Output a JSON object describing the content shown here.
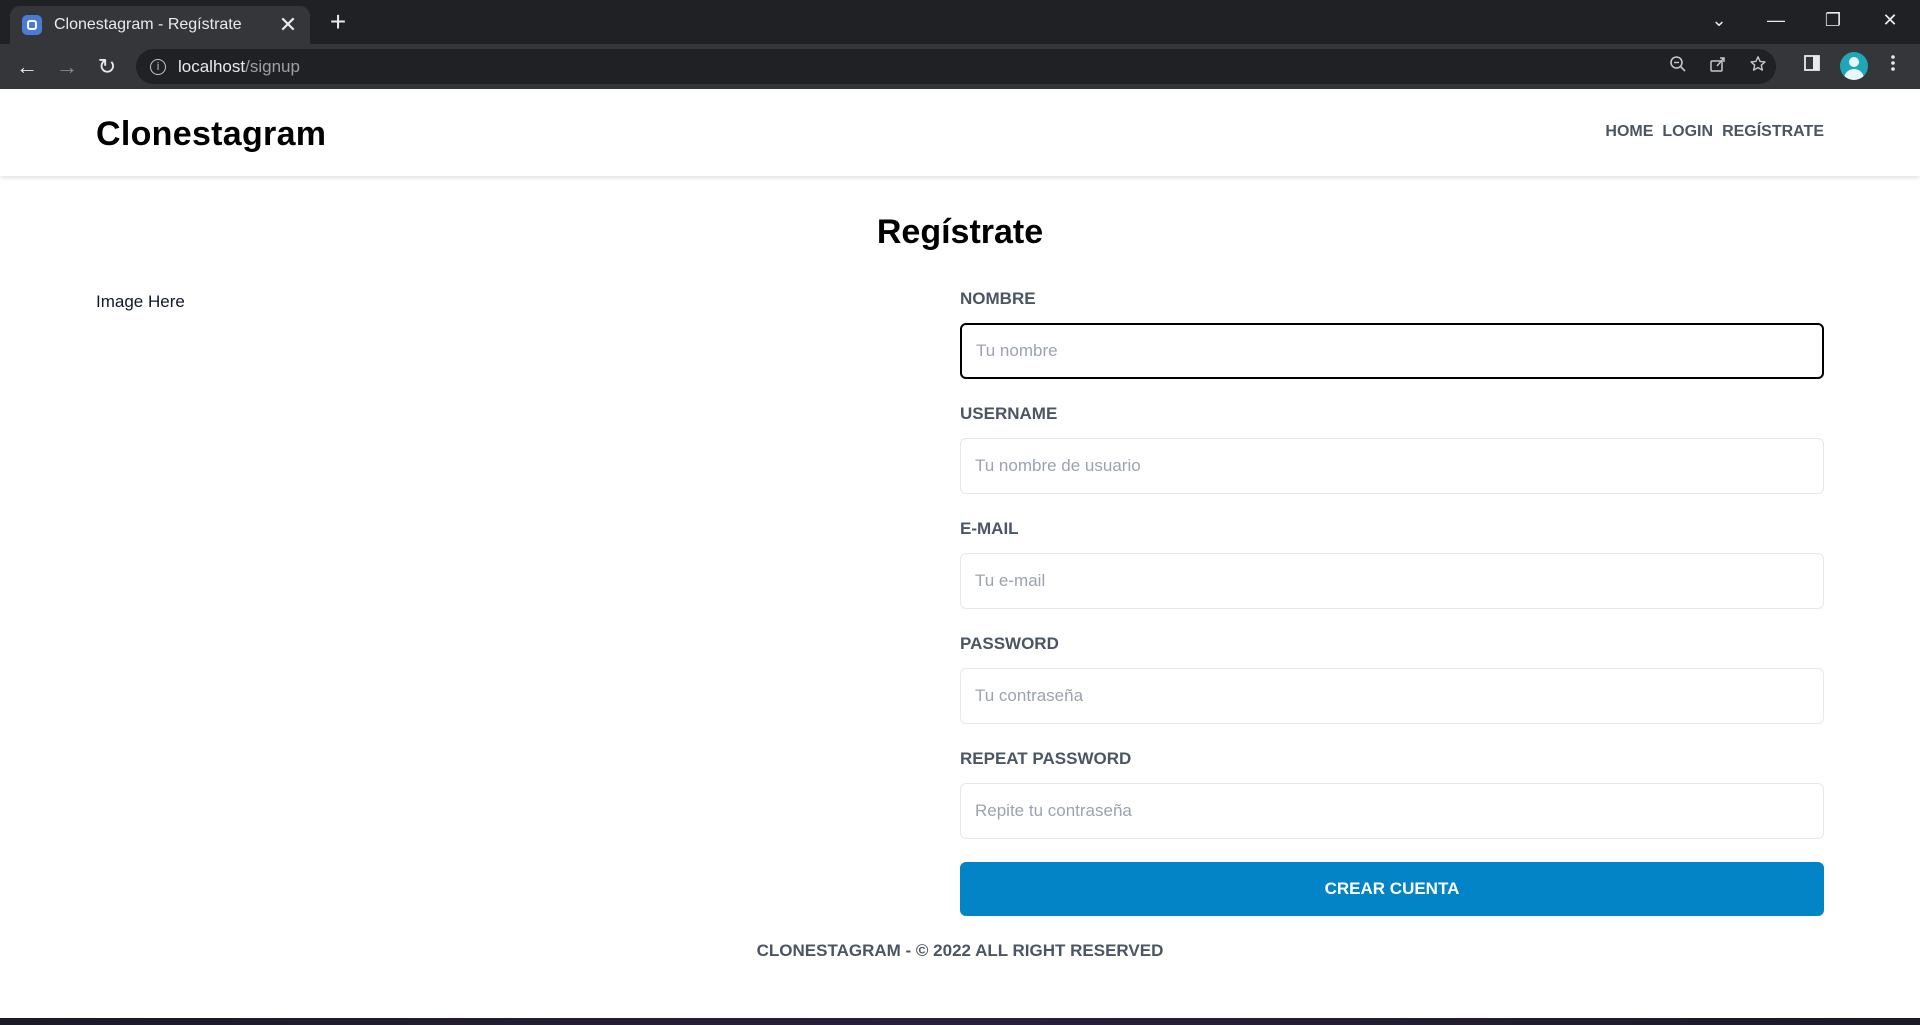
{
  "browser": {
    "tab_title": "Clonestagram - Regístrate",
    "tab_close": "✕",
    "new_tab": "+",
    "url_host": "localhost",
    "url_path": "/signup",
    "window_controls": {
      "dropdown": "⌄",
      "minimize": "—",
      "restore": "❐",
      "close": "✕"
    },
    "nav": {
      "back": "←",
      "forward": "→",
      "reload": "↻"
    },
    "icons": {
      "zoom": "zoom-icon",
      "share": "share-icon",
      "bookmark": "star-icon",
      "side_panel": "side-panel-icon",
      "menu": "kebab-menu-icon"
    }
  },
  "header": {
    "brand": "Clonestagram",
    "nav": [
      "Home",
      "Login",
      "Regístrate"
    ]
  },
  "main": {
    "title": "Regístrate",
    "image_placeholder": "Image Here"
  },
  "form": {
    "fields": [
      {
        "label": "Nombre",
        "placeholder": "Tu nombre",
        "value": ""
      },
      {
        "label": "Username",
        "placeholder": "Tu nombre de usuario",
        "value": ""
      },
      {
        "label": "E-mail",
        "placeholder": "Tu e-mail",
        "value": ""
      },
      {
        "label": "Password",
        "placeholder": "Tu contraseña",
        "value": ""
      },
      {
        "label": "Repeat password",
        "placeholder": "Repite tu contraseña",
        "value": ""
      }
    ],
    "submit_label": "Crear cuenta"
  },
  "footer": {
    "text": "Clonestagram - © 2022 All right reserved"
  },
  "colors": {
    "accent": "#0284c7",
    "label": "#4b5563",
    "border": "#e5e7eb"
  }
}
